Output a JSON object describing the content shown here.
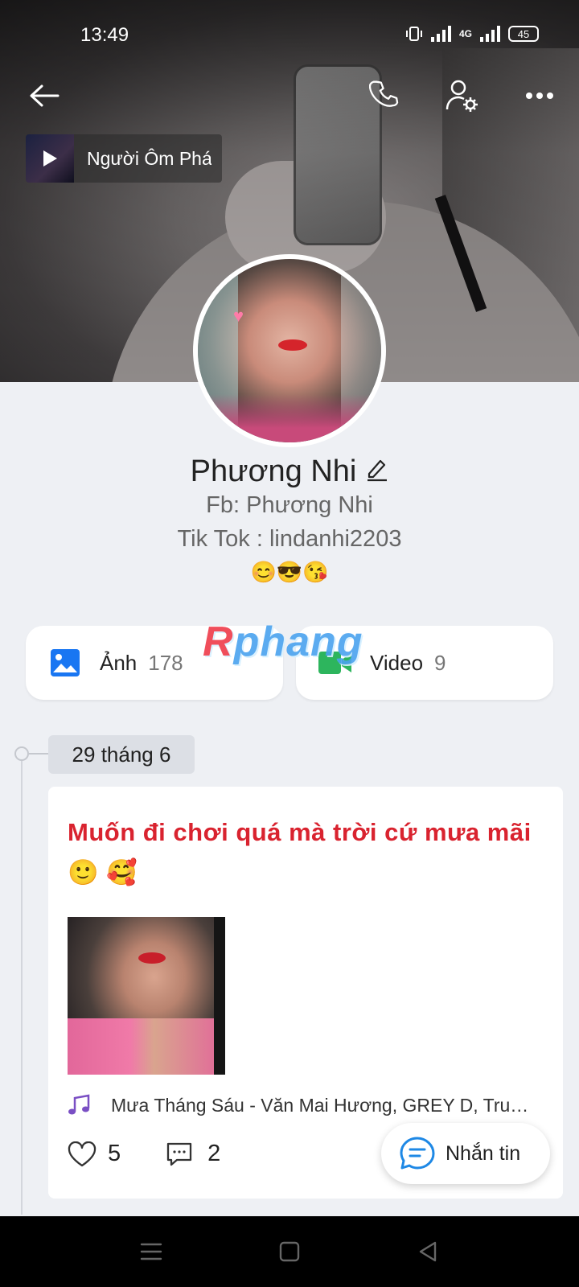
{
  "status_bar": {
    "time": "13:49",
    "network": "4G",
    "battery": "45"
  },
  "music_chip": {
    "title": "Người Ôm Phá"
  },
  "profile": {
    "name": "Phương Nhi",
    "bio_lines": [
      "Fb:  Phương Nhi",
      "Tik Tok :  lindanhi2203",
      "😊😎😘"
    ]
  },
  "media": {
    "photos": {
      "label": "Ảnh",
      "count": "178"
    },
    "videos": {
      "label": "Video",
      "count": "9"
    }
  },
  "watermark": {
    "r": "R",
    "rest": "phang"
  },
  "timeline": {
    "date": "29 tháng 6",
    "post": {
      "caption": "Muốn đi chơi quá mà trời cứ mưa mãi 🙂 🥰",
      "song": "Mưa Tháng Sáu - Văn Mai Hương, GREY D, Trung Quân",
      "likes": "5",
      "comments": "2"
    }
  },
  "fab": {
    "label": "Nhắn tin"
  },
  "colors": {
    "accent": "#1e88e5",
    "photo_icon": "#1976f2",
    "video_icon": "#2db55d",
    "caption": "#d9232f",
    "music_icon": "#7a4fc4"
  }
}
